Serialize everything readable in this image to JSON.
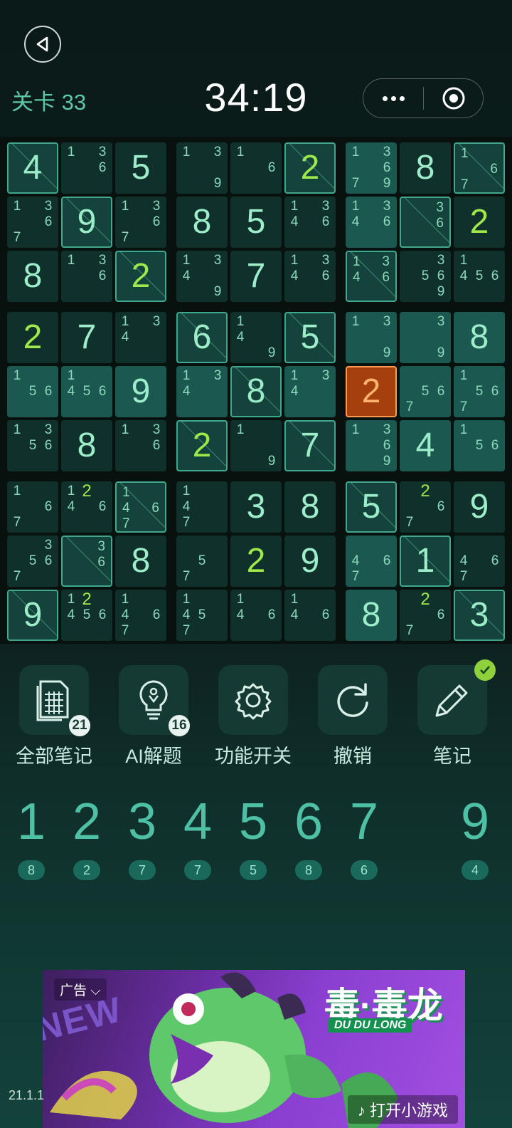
{
  "header": {
    "level_label": "关卡 33",
    "timer": "34:19"
  },
  "board": {
    "rows": [
      [
        {
          "v": "4",
          "boxed": true
        },
        {
          "n": [
            "1",
            "",
            "3",
            "",
            "",
            "6",
            "",
            "",
            ""
          ]
        },
        {
          "v": "5"
        },
        {
          "n": [
            "1",
            "",
            "3",
            "",
            "",
            "",
            "",
            "",
            "9"
          ]
        },
        {
          "n": [
            "1",
            "",
            "",
            "",
            "",
            "6",
            "",
            "",
            ""
          ]
        },
        {
          "v": "2",
          "user": true,
          "boxed": true
        },
        {
          "n": [
            "1",
            "",
            "3",
            "",
            "",
            "6",
            "7",
            "",
            "9"
          ],
          "hl": true
        },
        {
          "v": "8"
        },
        {
          "n": [
            "1",
            "",
            "",
            "",
            "",
            "6",
            "7",
            "",
            ""
          ],
          "boxed": true
        }
      ],
      [
        {
          "n": [
            "1",
            "",
            "3",
            "",
            "",
            "6",
            "7",
            "",
            ""
          ]
        },
        {
          "v": "9",
          "boxed": true
        },
        {
          "n": [
            "1",
            "",
            "3",
            "",
            "",
            "6",
            "7",
            "",
            ""
          ]
        },
        {
          "v": "8"
        },
        {
          "v": "5"
        },
        {
          "n": [
            "1",
            "",
            "3",
            "4",
            "",
            "6",
            "",
            "",
            ""
          ]
        },
        {
          "n": [
            "1",
            "",
            "3",
            "4",
            "",
            "6",
            "",
            "",
            ""
          ],
          "hl": true
        },
        {
          "n": [
            "",
            "",
            "3",
            "",
            "",
            "6",
            "",
            "",
            ""
          ],
          "boxed": true
        },
        {
          "v": "2",
          "user": true
        }
      ],
      [
        {
          "v": "8"
        },
        {
          "n": [
            "1",
            "",
            "3",
            "",
            "",
            "6",
            "",
            "",
            ""
          ]
        },
        {
          "v": "2",
          "user": true,
          "boxed": true
        },
        {
          "n": [
            "1",
            "",
            "3",
            "4",
            "",
            "",
            "",
            "",
            "9"
          ]
        },
        {
          "v": "7"
        },
        {
          "n": [
            "1",
            "",
            "3",
            "4",
            "",
            "6",
            "",
            "",
            ""
          ]
        },
        {
          "n": [
            "1",
            "",
            "3",
            "4",
            "",
            "6",
            "",
            "",
            ""
          ],
          "hl": true,
          "boxed": true
        },
        {
          "n": [
            "",
            "",
            "3",
            "",
            "5",
            "6",
            "",
            "",
            "9"
          ]
        },
        {
          "n": [
            "1",
            "",
            "",
            "4",
            "5",
            "6",
            "",
            "",
            ""
          ]
        }
      ],
      [
        {
          "v": "2",
          "user": true
        },
        {
          "v": "7"
        },
        {
          "n": [
            "1",
            "",
            "3",
            "4",
            "",
            "",
            "",
            "",
            ""
          ]
        },
        {
          "v": "6",
          "boxed": true
        },
        {
          "n": [
            "1",
            "",
            "",
            "4",
            "",
            "",
            "",
            "",
            "9"
          ]
        },
        {
          "v": "5",
          "boxed": true
        },
        {
          "n": [
            "1",
            "",
            "3",
            "",
            "",
            "",
            "",
            "",
            "9"
          ],
          "hl": true
        },
        {
          "n": [
            "",
            "",
            "3",
            "",
            "",
            "",
            "",
            "",
            "9"
          ],
          "hl": true
        },
        {
          "v": "8",
          "hl": true
        }
      ],
      [
        {
          "n": [
            "1",
            "",
            "",
            "",
            "5",
            "6",
            "",
            "",
            ""
          ],
          "hl": true
        },
        {
          "n": [
            "1",
            "",
            "",
            "4",
            "5",
            "6",
            "",
            "",
            ""
          ],
          "hl": true
        },
        {
          "v": "9",
          "hl": true
        },
        {
          "n": [
            "1",
            "",
            "3",
            "4",
            "",
            "",
            "",
            "",
            ""
          ],
          "hl": true
        },
        {
          "v": "8",
          "hl": true,
          "boxed": true
        },
        {
          "n": [
            "1",
            "",
            "3",
            "4",
            "",
            "",
            "",
            "",
            ""
          ],
          "hl": true
        },
        {
          "v": "2",
          "sel": true
        },
        {
          "n": [
            "",
            "",
            "",
            "",
            "5",
            "6",
            "7",
            "",
            ""
          ],
          "hl": true
        },
        {
          "n": [
            "1",
            "",
            "",
            "",
            "5",
            "6",
            "7",
            "",
            ""
          ],
          "hl": true
        }
      ],
      [
        {
          "n": [
            "1",
            "",
            "3",
            "",
            "5",
            "6",
            "",
            "",
            ""
          ]
        },
        {
          "v": "8"
        },
        {
          "n": [
            "1",
            "",
            "3",
            "",
            "",
            "6",
            "",
            "",
            ""
          ]
        },
        {
          "v": "2",
          "user": true,
          "boxed": true
        },
        {
          "n": [
            "1",
            "",
            "",
            "",
            "",
            "",
            "",
            "",
            "9"
          ]
        },
        {
          "v": "7",
          "boxed": true
        },
        {
          "n": [
            "1",
            "",
            "3",
            "",
            "",
            "6",
            "",
            "",
            "9"
          ],
          "hl": true
        },
        {
          "v": "4",
          "hl": true
        },
        {
          "n": [
            "1",
            "",
            "",
            "",
            "5",
            "6",
            "",
            "",
            ""
          ],
          "hl": true
        }
      ],
      [
        {
          "n": [
            "1",
            "",
            "",
            "",
            "",
            "6",
            "7",
            "",
            ""
          ]
        },
        {
          "n": [
            "1",
            "2",
            "",
            "4",
            "",
            "6",
            "",
            "",
            ""
          ]
        },
        {
          "n": [
            "1",
            "",
            "",
            "4",
            "",
            "6",
            "7",
            "",
            ""
          ],
          "boxed": true
        },
        {
          "n": [
            "1",
            "",
            "",
            "4",
            "",
            "",
            "7",
            "",
            ""
          ]
        },
        {
          "v": "3"
        },
        {
          "v": "8"
        },
        {
          "v": "5",
          "hl": true,
          "boxed": true
        },
        {
          "n": [
            "",
            "2",
            "",
            "",
            "",
            "6",
            "7",
            "",
            ""
          ]
        },
        {
          "v": "9"
        }
      ],
      [
        {
          "n": [
            "",
            "",
            "3",
            "",
            "5",
            "6",
            "7",
            "",
            ""
          ]
        },
        {
          "n": [
            "",
            "",
            "3",
            "",
            "",
            "6",
            "",
            "",
            ""
          ],
          "boxed": true
        },
        {
          "v": "8"
        },
        {
          "n": [
            "",
            "",
            "",
            "",
            "5",
            "",
            "7",
            "",
            ""
          ]
        },
        {
          "v": "2",
          "user": true
        },
        {
          "v": "9"
        },
        {
          "n": [
            "",
            "",
            "",
            "4",
            "",
            "6",
            "7",
            "",
            ""
          ],
          "hl": true
        },
        {
          "v": "1",
          "boxed": true
        },
        {
          "n": [
            "",
            "",
            "",
            "4",
            "",
            "6",
            "7",
            "",
            ""
          ]
        }
      ],
      [
        {
          "v": "9",
          "boxed": true
        },
        {
          "n": [
            "1",
            "2",
            "",
            "4",
            "5",
            "6",
            "",
            "",
            ""
          ]
        },
        {
          "n": [
            "1",
            "",
            "",
            "4",
            "",
            "6",
            "7",
            "",
            ""
          ]
        },
        {
          "n": [
            "1",
            "",
            "",
            "4",
            "5",
            "",
            "7",
            "",
            ""
          ]
        },
        {
          "n": [
            "1",
            "",
            "",
            "4",
            "",
            "6",
            "",
            "",
            ""
          ]
        },
        {
          "n": [
            "1",
            "",
            "",
            "4",
            "",
            "6",
            "",
            "",
            ""
          ]
        },
        {
          "v": "8",
          "hl": true
        },
        {
          "n": [
            "",
            "2",
            "",
            "",
            "",
            "6",
            "7",
            "",
            ""
          ]
        },
        {
          "v": "3",
          "boxed": true
        }
      ]
    ]
  },
  "tools": [
    {
      "label": "全部笔记",
      "icon": "notes-grid-icon",
      "badge": "21"
    },
    {
      "label": "AI解题",
      "icon": "lightbulb-icon",
      "badge": "16"
    },
    {
      "label": "功能开关",
      "icon": "gear-icon"
    },
    {
      "label": "撤销",
      "icon": "undo-icon"
    },
    {
      "label": "笔记",
      "icon": "pencil-icon",
      "checked": true
    }
  ],
  "numpad": [
    {
      "digit": "1",
      "count": "8"
    },
    {
      "digit": "2",
      "count": "2"
    },
    {
      "digit": "3",
      "count": "7"
    },
    {
      "digit": "4",
      "count": "7"
    },
    {
      "digit": "5",
      "count": "5"
    },
    {
      "digit": "6",
      "count": "8"
    },
    {
      "digit": "7",
      "count": "6"
    },
    {
      "digit": "",
      "count": ""
    },
    {
      "digit": "9",
      "count": "4"
    }
  ],
  "ad": {
    "label": "广告 ⌵",
    "badge_text": "NEW",
    "title": "毒·毒龙",
    "subtitle": "DU DU LONG",
    "cta": "♪ 打开小游戏"
  },
  "footer": {
    "version": "21.1.1"
  },
  "colors": {
    "accent": "#4ec1a5",
    "user_digit": "#9fe84a",
    "selected_cell": "#a5400e",
    "highlight_cell": "#1b5950",
    "cell": "#10312b"
  }
}
